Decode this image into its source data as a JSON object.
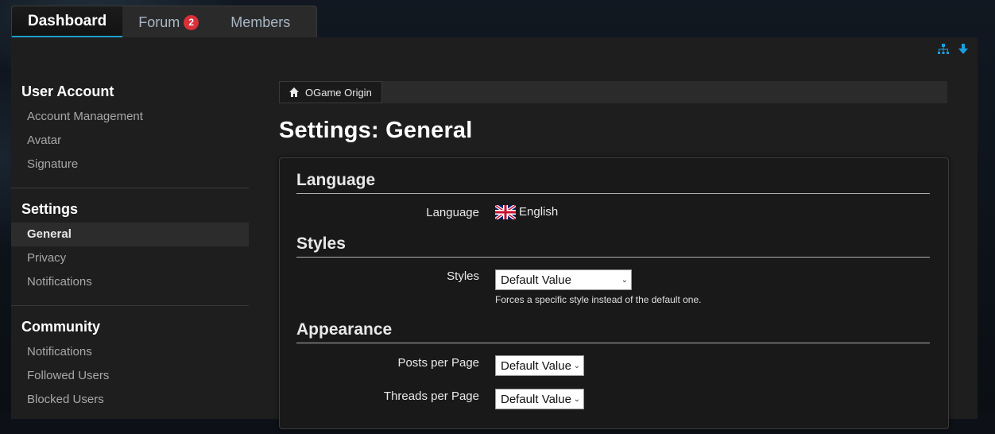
{
  "nav": {
    "tabs": [
      {
        "label": "Dashboard"
      },
      {
        "label": "Forum",
        "badge": "2"
      },
      {
        "label": "Members"
      }
    ]
  },
  "toplinks": {
    "sitemap_icon": "sitemap-icon",
    "down_icon": "arrow-down-icon"
  },
  "sidebar": {
    "sections": [
      {
        "title": "User Account",
        "items": [
          "Account Management",
          "Avatar",
          "Signature"
        ]
      },
      {
        "title": "Settings",
        "items": [
          "General",
          "Privacy",
          "Notifications"
        ]
      },
      {
        "title": "Community",
        "items": [
          "Notifications",
          "Followed Users",
          "Blocked Users"
        ]
      }
    ]
  },
  "breadcrumb": {
    "label": "OGame Origin"
  },
  "page": {
    "title": "Settings: General"
  },
  "form": {
    "language": {
      "title": "Language",
      "label": "Language",
      "value": "English"
    },
    "styles": {
      "title": "Styles",
      "label": "Styles",
      "value": "Default Value",
      "help": "Forces a specific style instead of the default one."
    },
    "appearance": {
      "title": "Appearance",
      "posts_label": "Posts per Page",
      "posts_value": "Default Value",
      "threads_label": "Threads per Page",
      "threads_value": "Default Value"
    }
  },
  "colors": {
    "accent": "#1aa0c8",
    "badge": "#d9303a",
    "link": "#1aa0e0"
  }
}
